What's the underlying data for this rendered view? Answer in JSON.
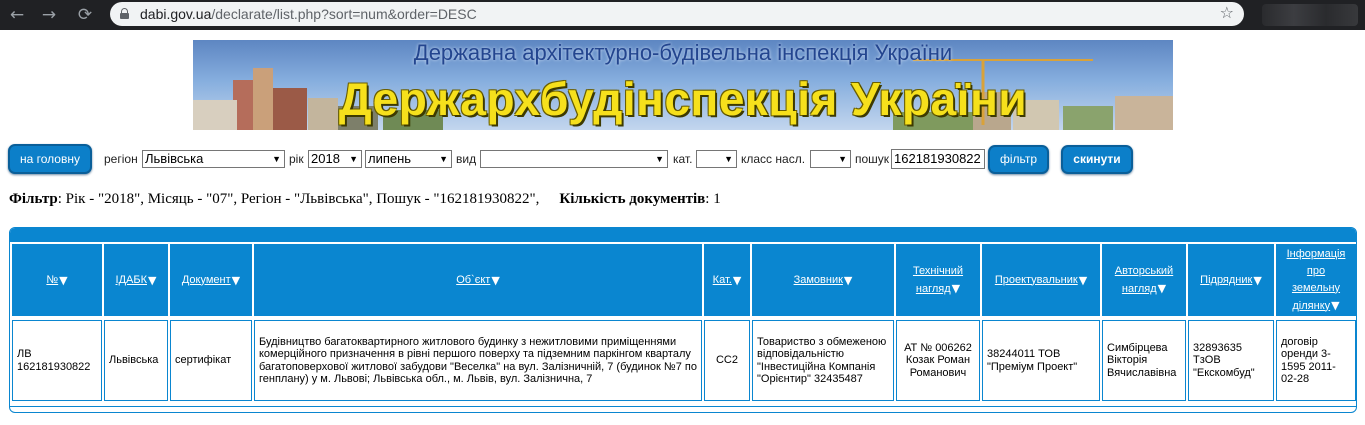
{
  "browser": {
    "url_host": "dabi.gov.ua",
    "url_path": "/declarate/list.php?sort=num&order=DESC"
  },
  "banner": {
    "subtitle": "Державна архітектурно-будівельна інспекція України",
    "title": "Держархбудінспекція України"
  },
  "toolbar": {
    "home_label": "на головну",
    "region_label": "регіон",
    "region_value": "Львівська",
    "year_label": "рік",
    "year_value": "2018",
    "month_value": "липень",
    "type_label": "вид",
    "type_value": "",
    "cat_label": "кат.",
    "cat_value": "",
    "class_label": "класс насл.",
    "class_value": "",
    "search_label": "пошук",
    "search_value": "162181930822",
    "filter_label": "фільтр",
    "reset_label": "скинути"
  },
  "summary": {
    "filter_title": "Фільтр",
    "filter_text": ": Рік - \"2018\", Місяць - \"07\", Регіон - \"Львівська\", Пошук - \"162181930822\",",
    "count_title": "Кількість документів",
    "count_text": ": 1"
  },
  "table": {
    "headers": [
      {
        "lines": [
          "№"
        ]
      },
      {
        "lines": [
          "ІДАБК"
        ]
      },
      {
        "lines": [
          "Документ"
        ]
      },
      {
        "lines": [
          "Об`єкт"
        ]
      },
      {
        "lines": [
          "Кат."
        ]
      },
      {
        "lines": [
          "Замовник"
        ]
      },
      {
        "lines": [
          "Технічний",
          "нагляд"
        ]
      },
      {
        "lines": [
          "Проектувальник"
        ]
      },
      {
        "lines": [
          "Авторський",
          "нагляд"
        ]
      },
      {
        "lines": [
          "Підрядник"
        ]
      },
      {
        "lines": [
          "Інформація",
          "про",
          "земельну",
          "ділянку"
        ]
      }
    ],
    "row": {
      "num_line1": "ЛВ",
      "num_line2": "162181930822",
      "idabk": "Львівська",
      "document": "сертифікат",
      "object": "Будівництво багатоквартирного житлового будинку з нежитловими приміщеннями комерційного призначення в рівні першого поверху та підземним паркінгом кварталу багатоповерхової житлової забудови \"Веселка\" на вул. Залізничній, 7 (будинок №7 по генплану) у м. Львові; Львівська обл., м. Львів, вул. Залізнична, 7",
      "cat": "СС2",
      "customer": "Товариство з обмеженою відповідальністю \"Інвестиційна Компанія \"Орієнтир\" 32435487",
      "tech_supervision": "АТ № 006262 Козак Роман Романович",
      "designer": "38244011 ТОВ \"Преміум Проект\"",
      "author_supervision": "Симбірцева Вікторія Вячиславівна",
      "contractor": "32893635 ТзОВ \"Екскомбуд\"",
      "land_info": "договір оренди 3-1595 2011-02-28"
    }
  }
}
